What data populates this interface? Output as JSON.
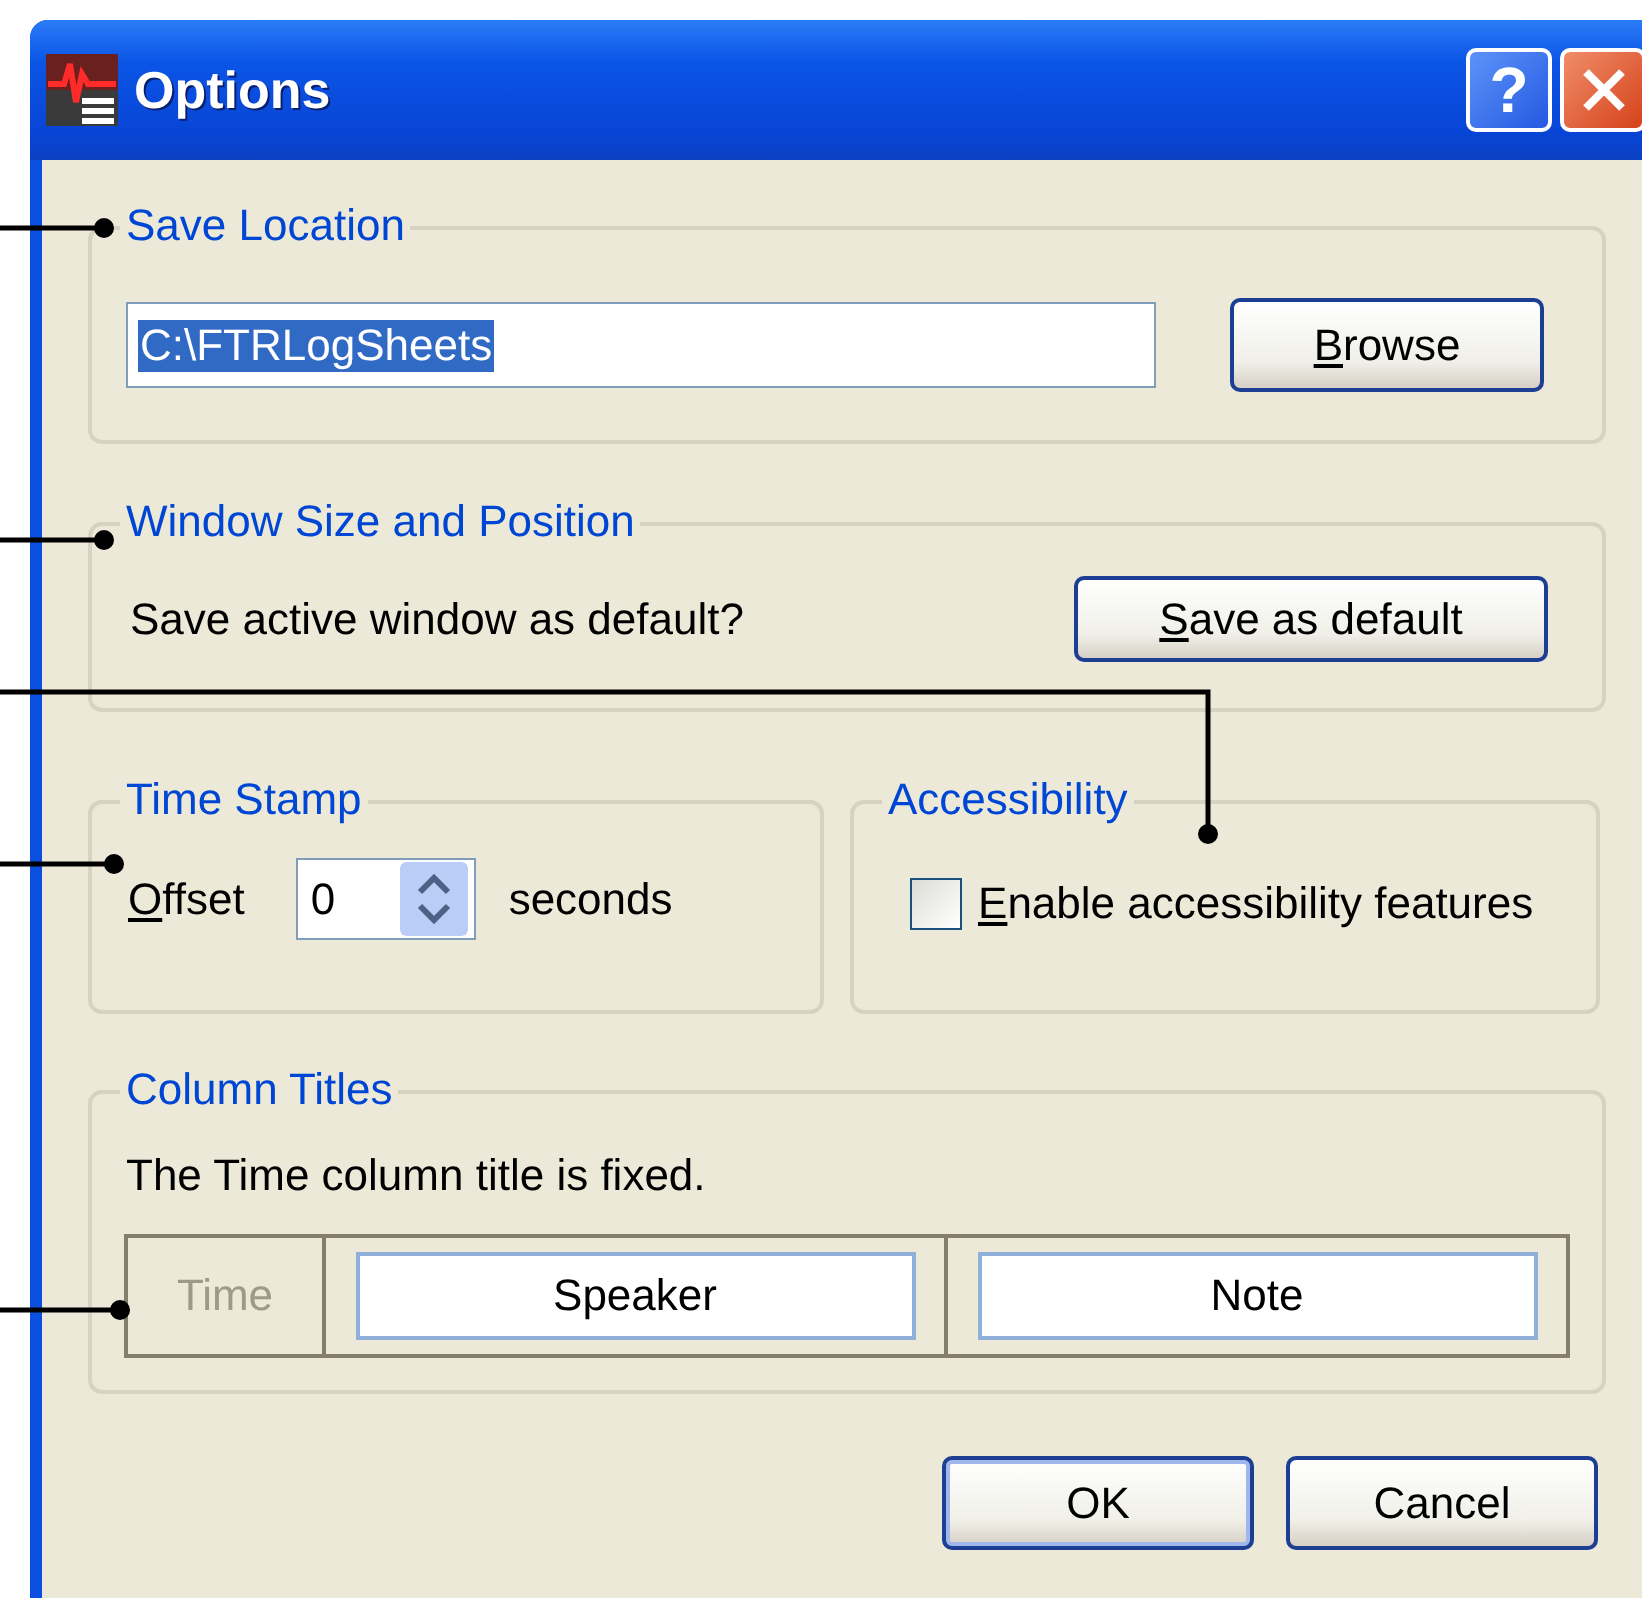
{
  "window": {
    "title": "Options"
  },
  "title_buttons": [
    {
      "kind": "help",
      "label": "?"
    },
    {
      "kind": "close"
    }
  ],
  "save_location": {
    "title": "Save Location",
    "path": {
      "value": "C:\\FTRLogSheets",
      "selected": true
    },
    "browse": {
      "label": "Browse",
      "mnemonic": true
    }
  },
  "window_size": {
    "title": "Window Size and Position",
    "prompt": "Save active window as default?",
    "button": {
      "label": "Save as default",
      "mnemonic": true
    }
  },
  "time_stamp": {
    "title": "Time Stamp",
    "label": {
      "text": "Offset",
      "mnemonic": true
    },
    "value": "0",
    "unit": "seconds"
  },
  "accessibility": {
    "title": "Accessibility",
    "checkbox": {
      "label": "Enable accessibility features",
      "checked": false,
      "mnemonic": true
    }
  },
  "column_titles": {
    "title": "Column Titles",
    "note": "The Time column title is fixed.",
    "columns": [
      {
        "label": "Time",
        "disabled": true
      },
      {
        "label": "Speaker",
        "disabled": false
      },
      {
        "label": "Note",
        "disabled": false
      }
    ]
  },
  "buttons": [
    {
      "label": "OK",
      "default": true
    },
    {
      "label": "Cancel",
      "default": false
    }
  ]
}
